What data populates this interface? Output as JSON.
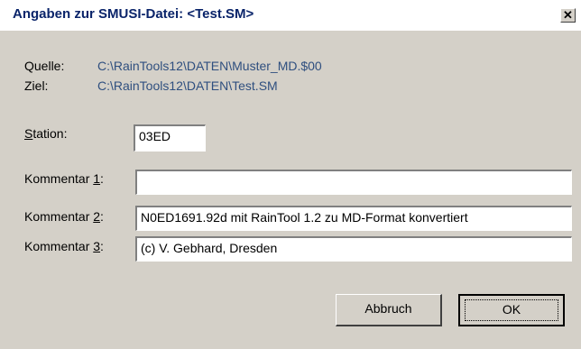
{
  "window": {
    "title": "Angaben zur SMUSI-Datei: <Test.SM>",
    "close_glyph": "✕"
  },
  "info": {
    "source_label": "Quelle:",
    "source_path": "C:\\RainTools12\\DATEN\\Muster_MD.$00",
    "target_label": "Ziel:",
    "target_path": "C:\\RainTools12\\DATEN\\Test.SM"
  },
  "station": {
    "label_prefix": "",
    "label_hotkey": "S",
    "label_suffix": "tation:",
    "value": "03ED"
  },
  "comments": [
    {
      "label_prefix": "Kommentar ",
      "label_hotkey": "1",
      "label_suffix": ":",
      "value": ""
    },
    {
      "label_prefix": "Kommentar ",
      "label_hotkey": "2",
      "label_suffix": ":",
      "value": "N0ED1691.92d mit RainTool 1.2 zu MD-Format konvertiert"
    },
    {
      "label_prefix": "Kommentar ",
      "label_hotkey": "3",
      "label_suffix": ":",
      "value": "(c) V. Gebhard, Dresden"
    }
  ],
  "buttons": {
    "cancel_label": "Abbruch",
    "ok_label": "OK"
  }
}
